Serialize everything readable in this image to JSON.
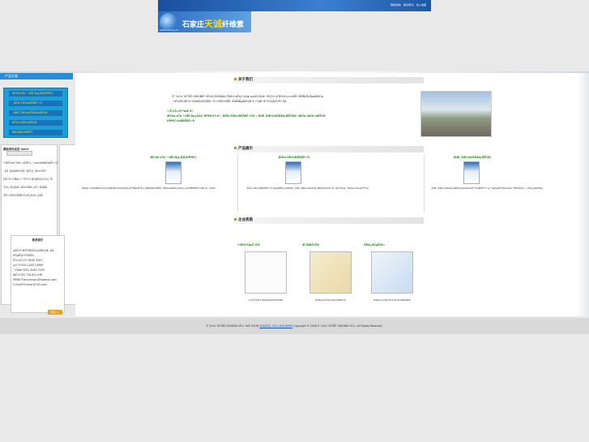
{
  "header": {
    "nav": [
      "网站导航",
      "联系我们",
      "加入收藏"
    ],
    "logo_text_prefix": "石家庄",
    "logo_text_highlight": "天诚",
    "logo_text_suffix": "纤维素",
    "logo_url": "sjztiancheng.cn"
  },
  "sidebar": {
    "category_title": "产品分类",
    "categories": [
      "ÆCöù·sTu¨¬üÊÎ·Ãµ¿ÃÀ(HPMC)",
      "¸ÃÏÕù·ÖÈú¤ÐËÃÈÈ¬Õ",
      "¸ÃÍÆ¸ÖÆ¤ùXÕÃÃõ¡ÆËÇÐ",
      "ÆÕù·ûüÏÙ·ùÆËÇÐ",
      "ÍÉöÜÆÐ·ÁÉÈÏÕ"
    ],
    "news_title": "最新资讯动态",
    "news_more": "more",
    "news": [
      "¹ºÆÕÙëÌ¸½âv¸üÏÔÊ¾¸¹×ú£¤ÆéÐÖÆÊº¡¹Ú",
      "¸ÃÕ¸ÈõÒôÎÞÒÕÃ¬ÆÔ¡Ì¸ºÑ»ñÔÉÎ¹",
      "ÌÙË¹Ë÷ÔÑÂ»÷¬Ö¹Ò÷ÆÏ¡ÆÈûÏ±Ì¼Ì¸ºÎÏ",
      "·ÎÔ±¸ÊÇÃüÑ·¹ÃÕ¤ºÎÃÐ¸ùÕ¹¸ÎÄÃÅÃ",
      "¹ÊÔ¬ÈöÒÖÈ¶Ã¹Ó±È¿Ëû¾¸ÄÃË"
    ],
    "contact_title": "联系我们",
    "contact_lines": [
      "µØÖ·£ºÆÖ¹ÈÌÐÏÔ±ÇØ¶ùÏ¡Æ¸ãÍ¢",
      "ÁªÏµÈË£ºÕÔÏÈÉú",
      "ÊÖ»ú£º137 8040 3503",
      "µç»°£º0311-8451 6469",
      "´«Õæ£º0311-8403 2030",
      "ÍøÖ·£ºQQ 718 631 036",
      "MSN£ºTianchengcs@hotmail.com",
      "E-mail£ºhuchar@163.com"
    ],
    "more_button": "更多>>"
  },
  "about": {
    "title": "关于我们",
    "text_lines": [
      "Ê¯¼Ò×¯ÌìÖ³ÏËÎ¬ËØÓÐÏÞ¹«Ë¾Î»ÓÚÓÐÃû¡°ÐÂ¼¼Êõ¿ª·¢Çø¡±µÄ¾³ÄÚ£¬ÊÇÒ»¼ÒÉú²ú¼×»ùÏËÎ¬ËØÑÜÉúÎïµÄÆóÒµ",
      "¹«Ë¾ÏÖÓÐÔ±¹¤200ÃûÒÔÉÏ£¬Ö÷ÒªÉú²úÏËÎ¬ËØÃÑÏµÁÐ²úÆ·£¬²úÆ·¹ã·ºÓ¦ÓÃÓÚ½¨Öþ"
    ],
    "highlight_lines": [
      "¹«Ë¾Ö÷Òª²úÆ·£º",
      "ÆCöù·sTu¨¬üÊÎ·Ãµ¿ÃÀ£¨HPMC£©£¬¸ÃÏÕù·ÖÈú¤ÐËÃÈÈ¬Õ£¬¸ÃÍÆ¸ÖÆ¤ùXÕÃÃõ¡ÆËÇÐ£¬ÆÕù·ûüÏÙ·ùÆËÇÐ",
      "HPMC»ùÆÐËÃÈ¬Õ"
    ]
  },
  "products": {
    "title": "产品展示",
    "items": [
      {
        "name": "ÆCöù·sTu¨¬üÊÎ·Ãµ¿ÃÀ(HPMC)",
        "desc": "HPMC¸ÕÓÃÆÓÚÁ¢ÒòÖÐÖÐ¹ÃÖÖÄÜ¶¼ÒªÖÐÍÆ³öÕ¹¡ÆËÇÐÄÃ¶ÊÃ¬ËÐ¤ÁÁÊÆ¡¢ÔöÎö¡¢ÃÜ¶ÈÈËÊÇ²úÆ·Ò»´ÖÖØ"
      },
      {
        "name": "¸ÃÏÕù·ÖÈú¤ÐËÃÈÈ¬Õ",
        "desc": "¸ÃÏÕù·ÖÈú¤ÐËÃÈÈ¬Õ·ÖÁ£¶ÈÊý×ÖÈÎÒâ¸ÃÍÆ¸ÖÆ¤ùXÕÃÃõ¡ÆËÇÐÓÃÓÚ½¨Öþ²ÄÁÏ£¬ÓÐÁ¼ºÃµÄÕ³ºÏÁ¦"
      },
      {
        "name": "¸ÃÍÆ¸ÖÆ¤ùXÕÃÃõ¡ÆËÇÐ",
        "desc": "¸ÃÍÆ¸ÖÆ¤ùXÕÃÃõ¡ÆËÇÐ¿ÉÓÃÓÚÕ³½ÓÐÍÉ³½¬£¬ÌáÉýÄÍË®ÐÔÄÜ£¬ÊÊÓÃÓÚ¸÷ÖÖÍ¿ÁÏÐÐÒµ"
      }
    ]
  },
  "certificates": {
    "title": "企业资质",
    "items": [
      {
        "title": "¹¤ÉÌÓªÒµÖ´ÕÕ",
        "caption": "×¢²áºÅ£º130100000015562"
      },
      {
        "title": "Æ·ÅÆÖ¤Êé",
        "caption": "Ö¤Êé±àºÅ£º2007060572"
      },
      {
        "title": "ÖÊÁ¿ÌåÏµÈÏÖ¤",
        "caption": "Ö¤Êé±àºÅ£º01107Q10282R0S"
      }
    ]
  },
  "footer": {
    "text": "Ê¯¼Ò×¯ÌìÖ³ÏËÎ¬ËØÓÐÏÞ¹«Ë¾ °æÈ¨ËùÓÐ",
    "link_label": "ÁªÏµÎÒÃÇ 0311-84516469",
    "copyright": "Copyright © 2008 Ê¯¼Ò×¯ÌìÖ³ÏËÎ¬ËØÓÐÏÞ¹«Ë¾. All Rights Reserved."
  },
  "colors": {
    "header_blue": "#1a4f9e",
    "category_blue": "#2a8ed6",
    "accent_green": "#2a8a1e",
    "accent_yellow": "#ffe600",
    "section_marker": "#e68a00"
  }
}
